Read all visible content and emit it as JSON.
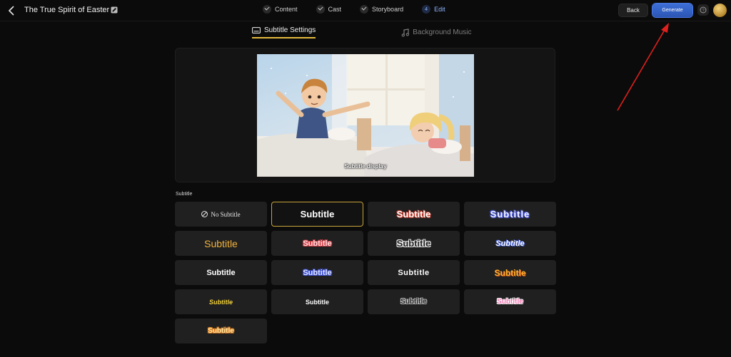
{
  "header": {
    "project_title": "The True Spirit of Easter",
    "steps": [
      {
        "label": "Content",
        "state": "done"
      },
      {
        "label": "Cast",
        "state": "done"
      },
      {
        "label": "Storyboard",
        "state": "done"
      },
      {
        "label": "Edit",
        "number": "4",
        "state": "active"
      }
    ],
    "back_label": "Back",
    "generate_label": "Generate"
  },
  "tabs": {
    "subtitle_settings": "Subtitle Settings",
    "background_music": "Background Music"
  },
  "preview": {
    "caption": "Subtitle display"
  },
  "subtitle_section": {
    "label": "Subtitle",
    "options": [
      {
        "text": "No Subtitle",
        "style": "none"
      },
      {
        "text": "Subtitle",
        "style": "plain-bold",
        "selected": true
      },
      {
        "text": "Subtitle",
        "style": "white-outline-red"
      },
      {
        "text": "Subtitle",
        "style": "blue-glow"
      },
      {
        "text": "Subtitle",
        "style": "orange-thin"
      },
      {
        "text": "Subtitle",
        "style": "pink-outline"
      },
      {
        "text": "Subtitle",
        "style": "white-outline-black"
      },
      {
        "text": "Subtitle",
        "style": "white-blue-outline"
      },
      {
        "text": "Subtitle",
        "style": "white-sans"
      },
      {
        "text": "Subtitle",
        "style": "blue-bubble"
      },
      {
        "text": "Subtitle",
        "style": "white-heavy"
      },
      {
        "text": "Subtitle",
        "style": "orange-bold"
      },
      {
        "text": "Subtitle",
        "style": "yellow-italic"
      },
      {
        "text": "Subtitle",
        "style": "white-small-bold"
      },
      {
        "text": "Subtitle",
        "style": "dark-outline"
      },
      {
        "text": "Subtitle",
        "style": "pink-white-outline"
      },
      {
        "text": "Subtitle",
        "style": "yellow-orange"
      }
    ]
  },
  "colors": {
    "accent_gold": "#e3b93e",
    "primary_blue": "#3d6fd6",
    "annotation_red": "#e0201c"
  }
}
